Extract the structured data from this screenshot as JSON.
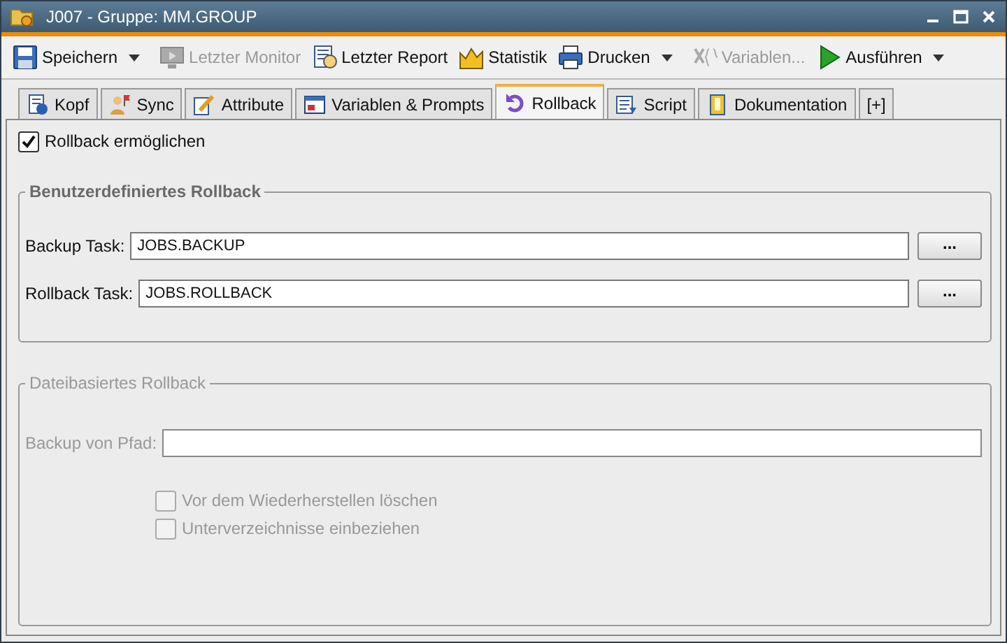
{
  "window": {
    "title": "J007 - Gruppe: MM.GROUP"
  },
  "toolbar": [
    {
      "label": "Speichern",
      "disabled": false,
      "dropdown": true
    },
    {
      "label": "Letzter Monitor",
      "disabled": true,
      "dropdown": false
    },
    {
      "label": "Letzter Report",
      "disabled": false,
      "dropdown": false
    },
    {
      "label": "Statistik",
      "disabled": false,
      "dropdown": false
    },
    {
      "label": "Drucken",
      "disabled": false,
      "dropdown": true
    },
    {
      "label": "Variablen...",
      "disabled": true,
      "dropdown": false
    },
    {
      "label": "Ausführen",
      "disabled": false,
      "dropdown": true
    }
  ],
  "tabs": [
    {
      "label": "Kopf",
      "selected": false
    },
    {
      "label": "Sync",
      "selected": false
    },
    {
      "label": "Attribute",
      "selected": false
    },
    {
      "label": "Variablen & Prompts",
      "selected": false
    },
    {
      "label": "Rollback",
      "selected": true
    },
    {
      "label": "Script",
      "selected": false
    },
    {
      "label": "Dokumentation",
      "selected": false
    },
    {
      "label": "[+]",
      "selected": false
    }
  ],
  "enable_rollback": {
    "label": "Rollback ermöglichen",
    "checked": true
  },
  "custom_rollback": {
    "title": "Benutzerdefiniertes Rollback",
    "disabled": false,
    "fields": [
      {
        "label": "Backup Task:",
        "value": "JOBS.BACKUP",
        "browse": "..."
      },
      {
        "label": "Rollback Task:",
        "value": "JOBS.ROLLBACK",
        "browse": "..."
      }
    ]
  },
  "file_rollback": {
    "title": "Dateibasiertes Rollback",
    "disabled": true,
    "fields": [
      {
        "label": "Backup von Pfad:"
      }
    ],
    "options": [
      {
        "label": "Vor dem Wiederherstellen löschen",
        "checked": false
      },
      {
        "label": "Unterverzeichnisse einbeziehen",
        "checked": false
      }
    ]
  }
}
